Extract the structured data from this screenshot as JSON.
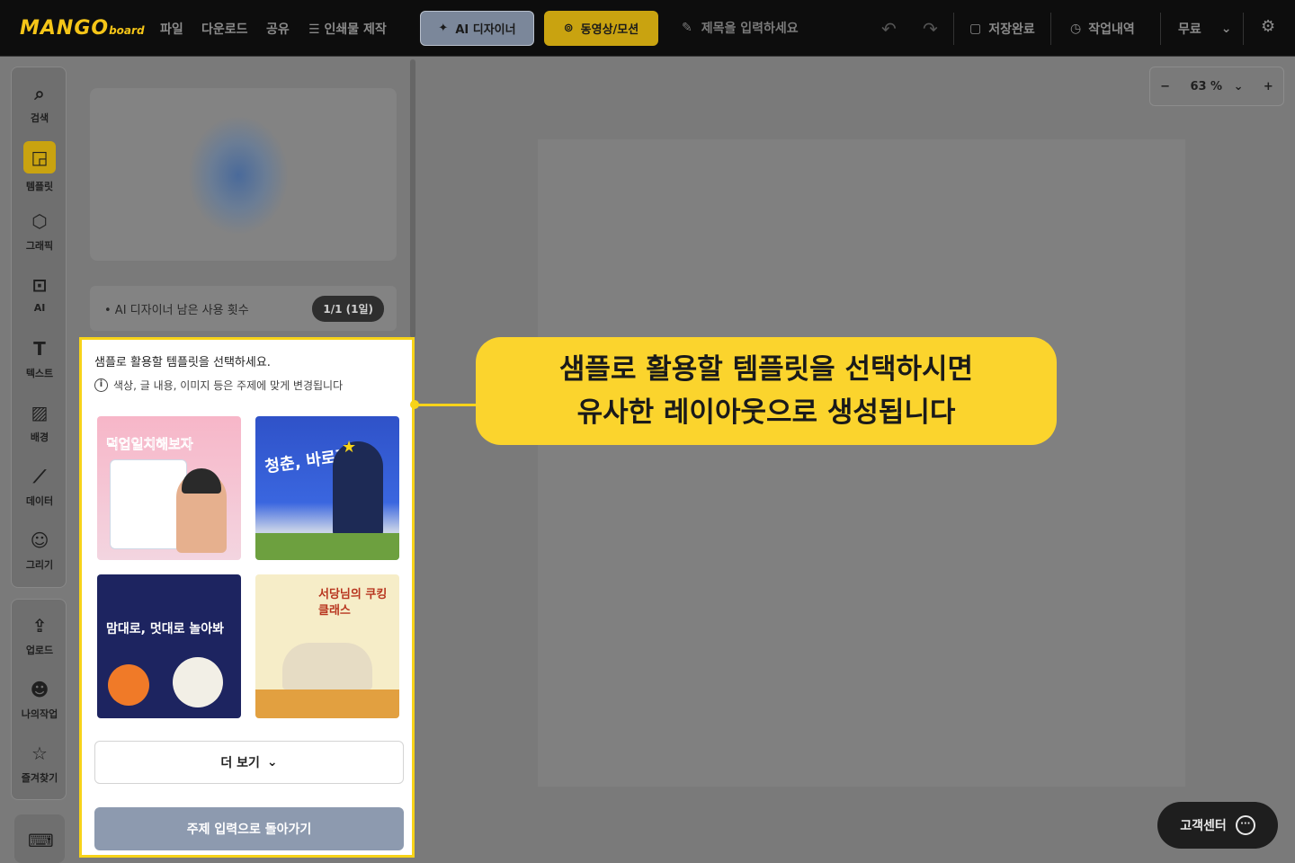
{
  "topbar": {
    "logo_main": "MANGO",
    "logo_sub": "board",
    "menu": [
      "파일",
      "다운로드",
      "공유",
      "인쇄물 제작"
    ],
    "ai_designer_label": "AI 디자이너",
    "video_label": "동영상/모션",
    "title_placeholder": "제목을 입력하세요",
    "save_status": "저장완료",
    "history_label": "작업내역",
    "plan_label": "무료"
  },
  "sidebar": {
    "items": [
      {
        "label": "검색",
        "icon": "search-icon"
      },
      {
        "label": "템플릿",
        "icon": "template-icon"
      },
      {
        "label": "그래픽",
        "icon": "graphic-icon"
      },
      {
        "label": "AI",
        "icon": "ai-chip-icon"
      },
      {
        "label": "텍스트",
        "icon": "text-icon"
      },
      {
        "label": "배경",
        "icon": "background-icon"
      },
      {
        "label": "데이터",
        "icon": "chart-icon"
      },
      {
        "label": "그리기",
        "icon": "draw-icon"
      }
    ],
    "items2": [
      {
        "label": "업로드",
        "icon": "upload-icon"
      },
      {
        "label": "나의작업",
        "icon": "my-work-icon"
      },
      {
        "label": "즐겨찾기",
        "icon": "favorite-icon"
      }
    ]
  },
  "panel": {
    "usage_label": "• AI 디자이너 남은 사용 횟수",
    "usage_badge": "1/1 (1일)",
    "select_title": "샘플로 활용할 템플릿을 선택하세요.",
    "select_note": "색상, 글 내용, 이미지 등은 주제에 맞게 변경됩니다",
    "templates": [
      {
        "text": "덕업일치해보자"
      },
      {
        "text": "청춘, 바로지금!"
      },
      {
        "text": "맘대로, 멋대로 놀아봐"
      },
      {
        "text": "서당님의 쿠킹클래스"
      }
    ],
    "more_label": "더 보기",
    "back_label": "주제 입력으로 돌아가기"
  },
  "zoom": {
    "minus": "−",
    "value": "63 %",
    "plus": "+"
  },
  "callout": {
    "line1": "샘플로 활용할 템플릿을 선택하시면",
    "line2": "유사한 레이아웃으로 생성됩니다"
  },
  "support": {
    "label": "고객센터"
  },
  "colors": {
    "accent_yellow": "#f7d319",
    "callout_bg": "#fbd42d",
    "back_button": "#8d9aaf"
  }
}
